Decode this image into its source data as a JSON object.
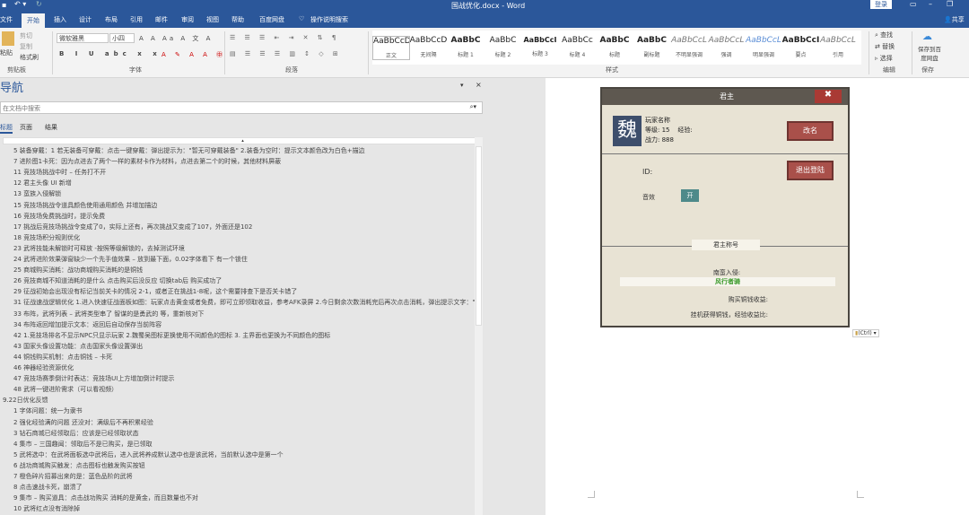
{
  "window": {
    "title": "国战优化.docx - Word",
    "login": "登录",
    "share": "共享"
  },
  "tabs": [
    "文件",
    "开始",
    "插入",
    "设计",
    "布局",
    "引用",
    "邮件",
    "审阅",
    "视图",
    "帮助",
    "百度网盘",
    "操作说明搜索"
  ],
  "ribbon": {
    "clipboard": {
      "paste": "粘贴",
      "cut": "剪切",
      "copy": "复制",
      "format_painter": "格式刷",
      "label": "剪贴板"
    },
    "font": {
      "name": "微软雅黑",
      "size": "小四",
      "label": "字体"
    },
    "paragraph": {
      "label": "段落"
    },
    "styles": {
      "label": "样式",
      "items": [
        {
          "sample": "AaBbCcD",
          "name": "正文"
        },
        {
          "sample": "AaBbCcD",
          "name": "无间隔"
        },
        {
          "sample": "AaBbC",
          "name": "标题 1"
        },
        {
          "sample": "AaBbC",
          "name": "标题 2"
        },
        {
          "sample": "AaBbCcI",
          "name": "标题 3"
        },
        {
          "sample": "AaBbCc",
          "name": "标题 4"
        },
        {
          "sample": "AaBbC",
          "name": "标题"
        },
        {
          "sample": "AaBbC",
          "name": "副标题"
        },
        {
          "sample": "AaBbCcL",
          "name": "不明显强调"
        },
        {
          "sample": "AaBbCcL",
          "name": "强调"
        },
        {
          "sample": "AaBbCcL",
          "name": "明显强调"
        },
        {
          "sample": "AaBbCcI",
          "name": "要点"
        },
        {
          "sample": "AaBbCcL",
          "name": "引用"
        }
      ]
    },
    "editing": {
      "find": "查找",
      "replace": "替换",
      "select": "选择",
      "label": "编辑"
    },
    "save": {
      "button": "保存到百度网盘",
      "label": "保存"
    }
  },
  "nav": {
    "title": "导航",
    "search_placeholder": "在文档中搜索",
    "tabs": [
      "标题",
      "页面",
      "结果"
    ],
    "items": [
      {
        "text": "5 装备穿戴：1 若无装备可穿戴：点击一键穿戴：弹出提示为：\"暂无可穿戴装备\" 2.装备为空时：提示文本颜色改为白色+描边",
        "level": 2
      },
      {
        "text": "7 进阶图1卡死：因为点进去了两个一样的素材卡作为材料，点进去第二个的时候，其他材料屏蔽",
        "level": 2
      },
      {
        "text": "11 竞技场挑战中时 – 任务打不开",
        "level": 2
      },
      {
        "text": "12 君主头像 UI 新增",
        "level": 2
      },
      {
        "text": "13 蛮族入侵解锁",
        "level": 2
      },
      {
        "text": "15 竞技场挑战令道具颜色使用通用颜色 并增加描边",
        "level": 2
      },
      {
        "text": "16 竞技场免费挑战时，提示免费",
        "level": 2
      },
      {
        "text": "17 挑战后竞技场挑战令变成了0，实际上还有，再次挑战又变成了107，外面还是102",
        "level": 2
      },
      {
        "text": "18 竞技场积分规则优化",
        "level": 2
      },
      {
        "text": "23 武将技能未解锁时可释放 -按照等级解锁的，去掉测试环境",
        "level": 2
      },
      {
        "text": "24 武将进阶效果弹窗缺少一个先手值效果 – 放到最下面，0.02字体看下 有一个锁住",
        "level": 2
      },
      {
        "text": "25 商城购买消耗：战功商城购买消耗的是铜钱",
        "level": 2
      },
      {
        "text": "26 竞技商城不知道消耗的是什么 点击购买后没反应 切换tab后 购买成功了",
        "level": 2
      },
      {
        "text": "29 征战初始会出现没有标记当前关卡的情况 2-1，或者正在挑战1-8呢，这个需要排查下是否关卡错了",
        "level": 2
      },
      {
        "text": "31 征战速战逻辑优化 1.进入快速征战面板如图：玩家点击黄金或者免费，即可立即领取收益，参考AFK录屏 2.今日剩余次数消耗完后再次点击消耗，弹出提示文字：\"...",
        "level": 2
      },
      {
        "text": "33 布阵，武将列表 – 武将类型串了 智谋的是勇武的 等，重新核对下",
        "level": 2
      },
      {
        "text": "34 布阵返回增加提示文本：返回后自动保存当前阵容",
        "level": 2
      },
      {
        "text": "42 1.竞技场排名不显示NPC只显示玩家 2.魏蜀吴图标更换使用不同颜色的图标 3. 主界面也更换为不同颜色的图标",
        "level": 2
      },
      {
        "text": "43 国家头像设置功能：点击国家头像设置弹出",
        "level": 2
      },
      {
        "text": "44 铜钱购买机制：点击铜钱 – 卡死",
        "level": 2
      },
      {
        "text": "46 神器经验资源优化",
        "level": 2
      },
      {
        "text": "47 竞技场赛季倒计时表达：竞技场UI上方增加倒计时提示",
        "level": 2
      },
      {
        "text": "48 武将一键进阶需求（可以看视频）",
        "level": 2
      },
      {
        "text": "9.22日优化反馈",
        "level": 1
      },
      {
        "text": "1 字体问题：统一为隶书",
        "level": 2
      },
      {
        "text": "2 强化经验满的问题 还没对：满级后不再积累经验",
        "level": 2
      },
      {
        "text": "3 钻石商城已经领取后：应该是已经领取状态",
        "level": 2
      },
      {
        "text": "4 集市 – 三国趣闻：领取后不是已购买，是已领取",
        "level": 2
      },
      {
        "text": "5 武将选中：在武将面板选中武将后，进入武将养成默认选中也是该武将，当前默认选中是第一个",
        "level": 2
      },
      {
        "text": "6 战功商城购买触发：点击图标也触发购买按钮",
        "level": 2
      },
      {
        "text": "7 橙色碎片招募出来的是：蓝色品阶的武将",
        "level": 2
      },
      {
        "text": "8 点击速战卡死，崩溃了",
        "level": 2
      },
      {
        "text": "9 集市 – 购买道具：点击战功购买 消耗的是黄金，而且数量也不对",
        "level": 2
      },
      {
        "text": "10 武将红点没有消除掉",
        "level": 2
      }
    ]
  },
  "game": {
    "header": "君主",
    "emblem": "魏",
    "player_name": "玩家名称",
    "level_label": "等级:",
    "level": "15",
    "exp_label": "经验:",
    "power_label": "战力:",
    "power": "888",
    "rename": "改名",
    "id_label": "ID:",
    "logout": "退出登陆",
    "sound_label": "音效",
    "sound_toggle": "开",
    "title_section": "君主称号",
    "line1": "南蛮入侵:",
    "highlight": "风行者骑",
    "line2": "购买铜钱收益:",
    "line3": "挂机获得铜钱，经验收益比:"
  },
  "paste_options": "(Ctrl)",
  "colors": {
    "accent": "#2b579a",
    "button": "#a9504a",
    "toggle": "#4e8a8a"
  }
}
